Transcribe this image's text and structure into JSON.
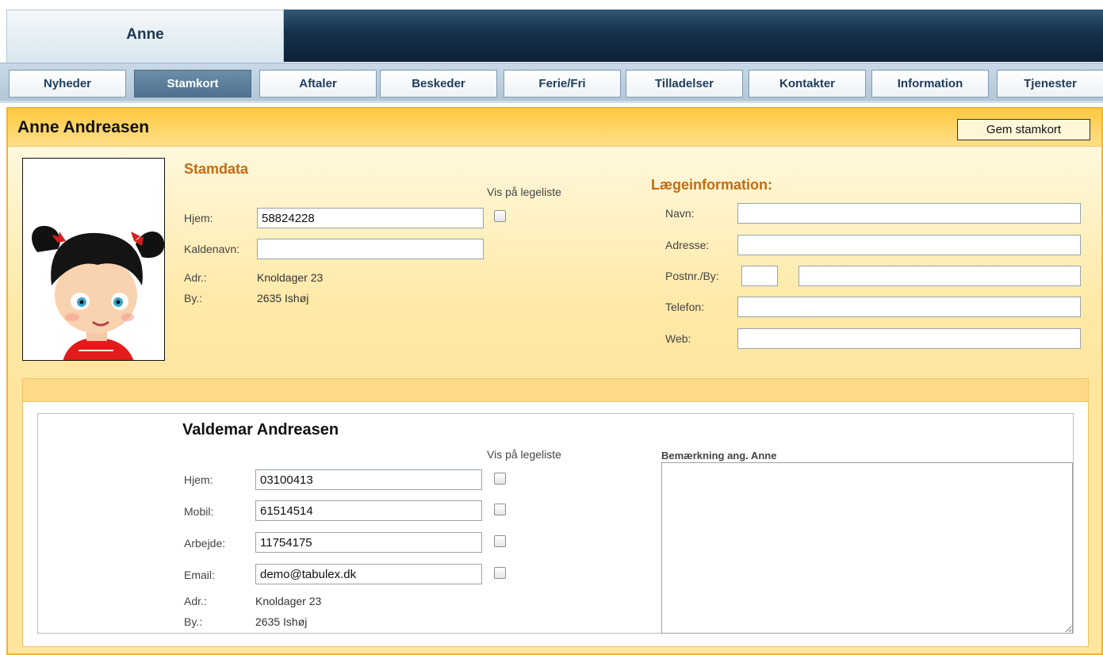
{
  "header": {
    "child_tab_label": "Anne"
  },
  "nav": {
    "items": [
      {
        "label": "Nyheder"
      },
      {
        "label": "Stamkort"
      },
      {
        "label": "Aftaler"
      },
      {
        "label": "Beskeder"
      },
      {
        "label": "Ferie/Fri"
      },
      {
        "label": "Tilladelser"
      },
      {
        "label": "Kontakter"
      },
      {
        "label": "Information"
      },
      {
        "label": "Tjenester"
      }
    ],
    "active": "Stamkort"
  },
  "panel": {
    "title": "Anne Andreasen",
    "save_button": "Gem stamkort"
  },
  "stamdata": {
    "title": "Stamdata",
    "vis_label": "Vis på legeliste",
    "hjem_label": "Hjem:",
    "hjem_value": "58824228",
    "kaldenavn_label": "Kaldenavn:",
    "kaldenavn_value": "",
    "adr_label": "Adr.:",
    "adr_value": "Knoldager 23",
    "by_label": "By.:",
    "by_value": "2635 Ishøj"
  },
  "laege": {
    "title": "Lægeinformation:",
    "navn_label": "Navn:",
    "adresse_label": "Adresse:",
    "postnr_label": "Postnr./By:",
    "telefon_label": "Telefon:",
    "web_label": "Web:"
  },
  "parent": {
    "name": "Valdemar Andreasen",
    "vis_label": "Vis på legeliste",
    "hjem_label": "Hjem:",
    "hjem_value": "03100413",
    "mobil_label": "Mobil:",
    "mobil_value": "61514514",
    "arbejde_label": "Arbejde:",
    "arbejde_value": "11754175",
    "email_label": "Email:",
    "email_value": "demo@tabulex.dk",
    "adr_label": "Adr.:",
    "adr_value": "Knoldager 23",
    "by_label": "By.:",
    "by_value": "2635 Ishøj",
    "note_label": "Bemærkning ang. Anne"
  }
}
